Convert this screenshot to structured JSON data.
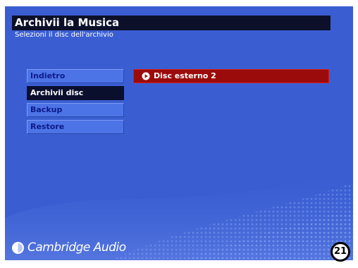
{
  "screen": {
    "title": "Archivii la Musica",
    "subtitle": "Selezioni il disc dell'archivio"
  },
  "menu": {
    "items": [
      {
        "label": "Indietro",
        "active": false
      },
      {
        "label": "Archivii disc",
        "active": true
      },
      {
        "label": "Backup",
        "active": false
      },
      {
        "label": "Restore",
        "active": false
      }
    ]
  },
  "options": {
    "selected_label": "Disc esterno 2",
    "icon": "play-circle-icon"
  },
  "brand": {
    "name": "Cambridge Audio",
    "logo_icon": "cambridge-audio-logo-icon"
  },
  "page_number": "21",
  "colors": {
    "background": "#3a5ed2",
    "title_bar": "#0c1029",
    "menu_item": "#4d74e7",
    "menu_active": "#0a0f2e",
    "option_selected": "#9c0b0b"
  }
}
